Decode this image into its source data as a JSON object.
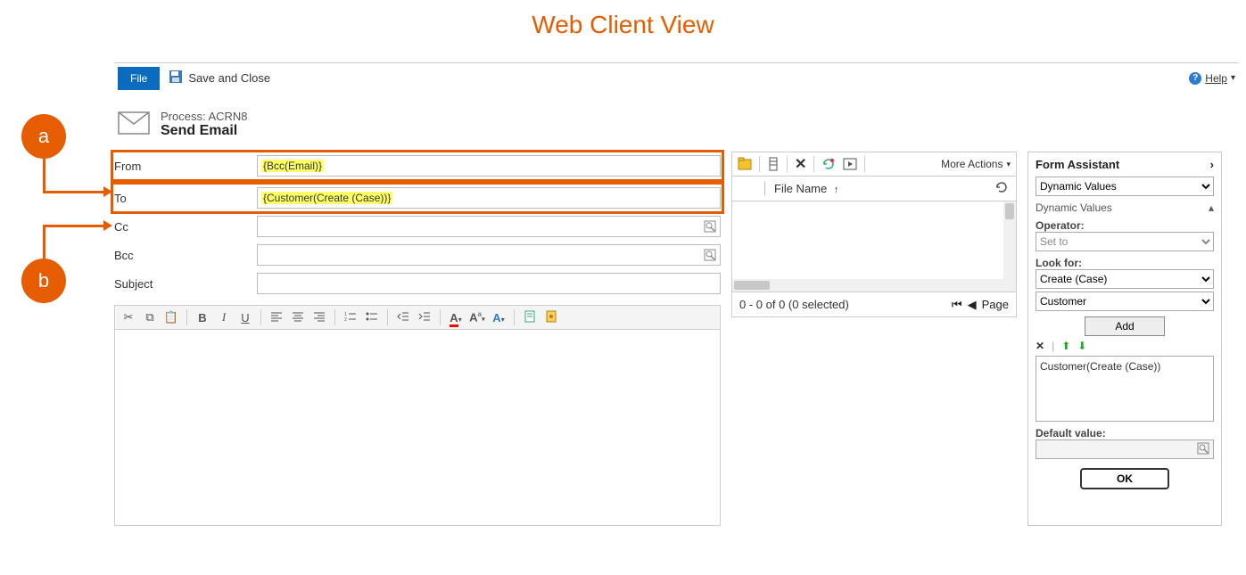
{
  "page_heading": "Web Client View",
  "toolbar": {
    "file_label": "File",
    "save_close_label": "Save and Close",
    "help_label": "Help"
  },
  "header": {
    "process_line": "Process: ACRN8",
    "title": "Send Email"
  },
  "fields": {
    "from_label": "From",
    "from_value": "{Bcc(Email)}",
    "to_label": "To",
    "to_value": "{Customer(Create (Case))}",
    "cc_label": "Cc",
    "cc_value": "",
    "bcc_label": "Bcc",
    "bcc_value": "",
    "subject_label": "Subject",
    "subject_value": ""
  },
  "editor": {
    "icons": {
      "cut": "cut-icon",
      "copy": "copy-icon",
      "paste": "paste-icon",
      "bold": "B",
      "italic": "I",
      "underline_u": "U",
      "align_left": "align-left-icon",
      "align_center": "align-center-icon",
      "align_right": "align-right-icon",
      "list_num": "numbered-list-icon",
      "list_bul": "bulleted-list-icon",
      "outdent": "outdent-icon",
      "indent": "indent-icon",
      "highlight": "highlight-icon",
      "font_size": "A",
      "font_color": "A",
      "insert": "insert-icon",
      "security": "security-icon"
    }
  },
  "attachments": {
    "more_actions_label": "More Actions",
    "col_filename": "File Name",
    "status_text": "0 - 0 of 0 (0 selected)",
    "page_label": "Page"
  },
  "assistant": {
    "title": "Form Assistant",
    "dropdown1": "Dynamic Values",
    "section_label": "Dynamic Values",
    "operator_label": "Operator:",
    "operator_value": "Set to",
    "lookfor_label": "Look for:",
    "lookfor1": "Create (Case)",
    "lookfor2": "Customer",
    "add_label": "Add",
    "values_item": "Customer(Create (Case))",
    "default_label": "Default value:",
    "default_value": "",
    "ok_label": "OK"
  },
  "callouts": {
    "a": "a",
    "b": "b"
  }
}
